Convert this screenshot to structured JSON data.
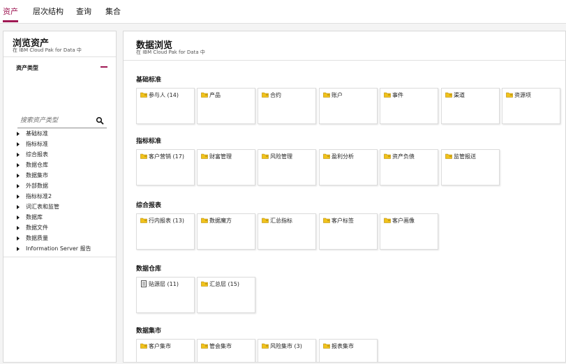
{
  "top_nav": {
    "tabs": [
      {
        "label": "资产",
        "active": true
      },
      {
        "label": "层次结构",
        "active": false
      },
      {
        "label": "查询",
        "active": false
      },
      {
        "label": "集合",
        "active": false
      }
    ]
  },
  "left_panel": {
    "title": "浏览资产",
    "subtitle": "在 IBM Cloud Pak for Data 中",
    "asset_type_label": "资产类型",
    "search_placeholder": "搜索资产类型",
    "tree_items": [
      "基础标准",
      "指标标准",
      "综合报表",
      "数据仓库",
      "数据集市",
      "外部数据",
      "指标标准2",
      "词汇表和监管",
      "数据库",
      "数据文件",
      "数据质量",
      "Information Server 报告"
    ]
  },
  "right_panel": {
    "title": "数据浏览",
    "subtitle": "在 IBM Cloud Pak for Data 中",
    "sections": [
      {
        "title": "基础标准",
        "tiles": [
          {
            "label": "参与人 (14)",
            "icon": "folder-icon"
          },
          {
            "label": "产品",
            "icon": "folder-icon"
          },
          {
            "label": "合约",
            "icon": "folder-icon"
          },
          {
            "label": "账户",
            "icon": "folder-icon"
          },
          {
            "label": "事件",
            "icon": "folder-icon"
          },
          {
            "label": "渠道",
            "icon": "folder-icon"
          },
          {
            "label": "资源项",
            "icon": "folder-icon"
          }
        ]
      },
      {
        "title": "指标标准",
        "tiles": [
          {
            "label": "客户营销 (17)",
            "icon": "folder-icon"
          },
          {
            "label": "财富管理",
            "icon": "folder-icon"
          },
          {
            "label": "风险管理",
            "icon": "folder-icon"
          },
          {
            "label": "盈利分析",
            "icon": "folder-icon"
          },
          {
            "label": "资产负债",
            "icon": "folder-icon"
          },
          {
            "label": "监管报送",
            "icon": "folder-icon"
          }
        ]
      },
      {
        "title": "综合报表",
        "tiles": [
          {
            "label": "行内报表 (13)",
            "icon": "folder-icon"
          },
          {
            "label": "数据魔方",
            "icon": "folder-icon"
          },
          {
            "label": "汇总指标",
            "icon": "folder-icon"
          },
          {
            "label": "客户标签",
            "icon": "folder-icon"
          },
          {
            "label": "客户画像",
            "icon": "folder-icon"
          }
        ]
      },
      {
        "title": "数据仓库",
        "tiles": [
          {
            "label": "贴源层 (11)",
            "icon": "document-icon"
          },
          {
            "label": "汇总层 (15)",
            "icon": "folder-icon"
          }
        ]
      },
      {
        "title": "数据集市",
        "tiles": [
          {
            "label": "客户集市",
            "icon": "folder-icon"
          },
          {
            "label": "管会集市",
            "icon": "folder-icon"
          },
          {
            "label": "风险集市 (3)",
            "icon": "folder-icon"
          },
          {
            "label": "报表集市",
            "icon": "folder-icon"
          }
        ]
      }
    ]
  },
  "colors": {
    "accent": "#9f1853",
    "folder": "#f1c21b"
  }
}
